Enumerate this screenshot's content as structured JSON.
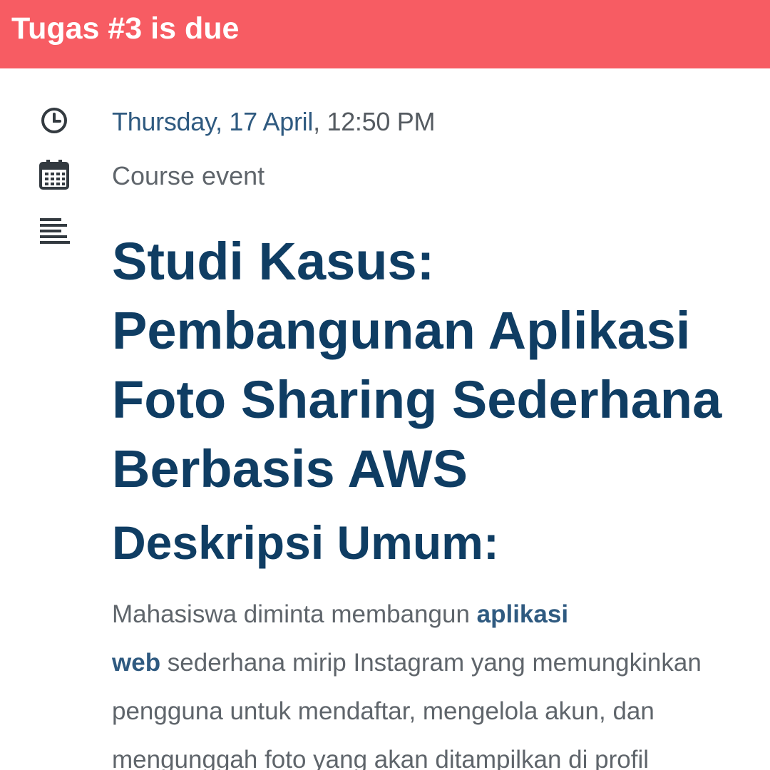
{
  "banner": {
    "title": "Tugas #3 is due",
    "color": "#f75c63"
  },
  "meta": {
    "date_link": "Thursday, 17 April",
    "time": ", 12:50 PM",
    "event_type": "Course event",
    "icons": [
      "clock-icon",
      "calendar-icon",
      "description-icon"
    ]
  },
  "content": {
    "title_lines": [
      "Studi Kasus:",
      "Pembangunan Aplikasi",
      "Foto Sharing Sederhana",
      "Berbasis AWS"
    ],
    "subtitle": "Deskripsi Umum:",
    "paragraph": {
      "line1_text": "Mahasiswa diminta membangun ",
      "line1_strong": "aplikasi",
      "line2_strong": "web",
      "line2_text": " sederhana mirip Instagram yang memungkinkan",
      "line3": "pengguna untuk mendaftar, mengelola akun, dan",
      "line4": "mengunggah foto yang akan ditampilkan di profil"
    }
  },
  "colors": {
    "heading": "#0f3d63",
    "link": "#2f5a80",
    "text": "#5f656b"
  }
}
